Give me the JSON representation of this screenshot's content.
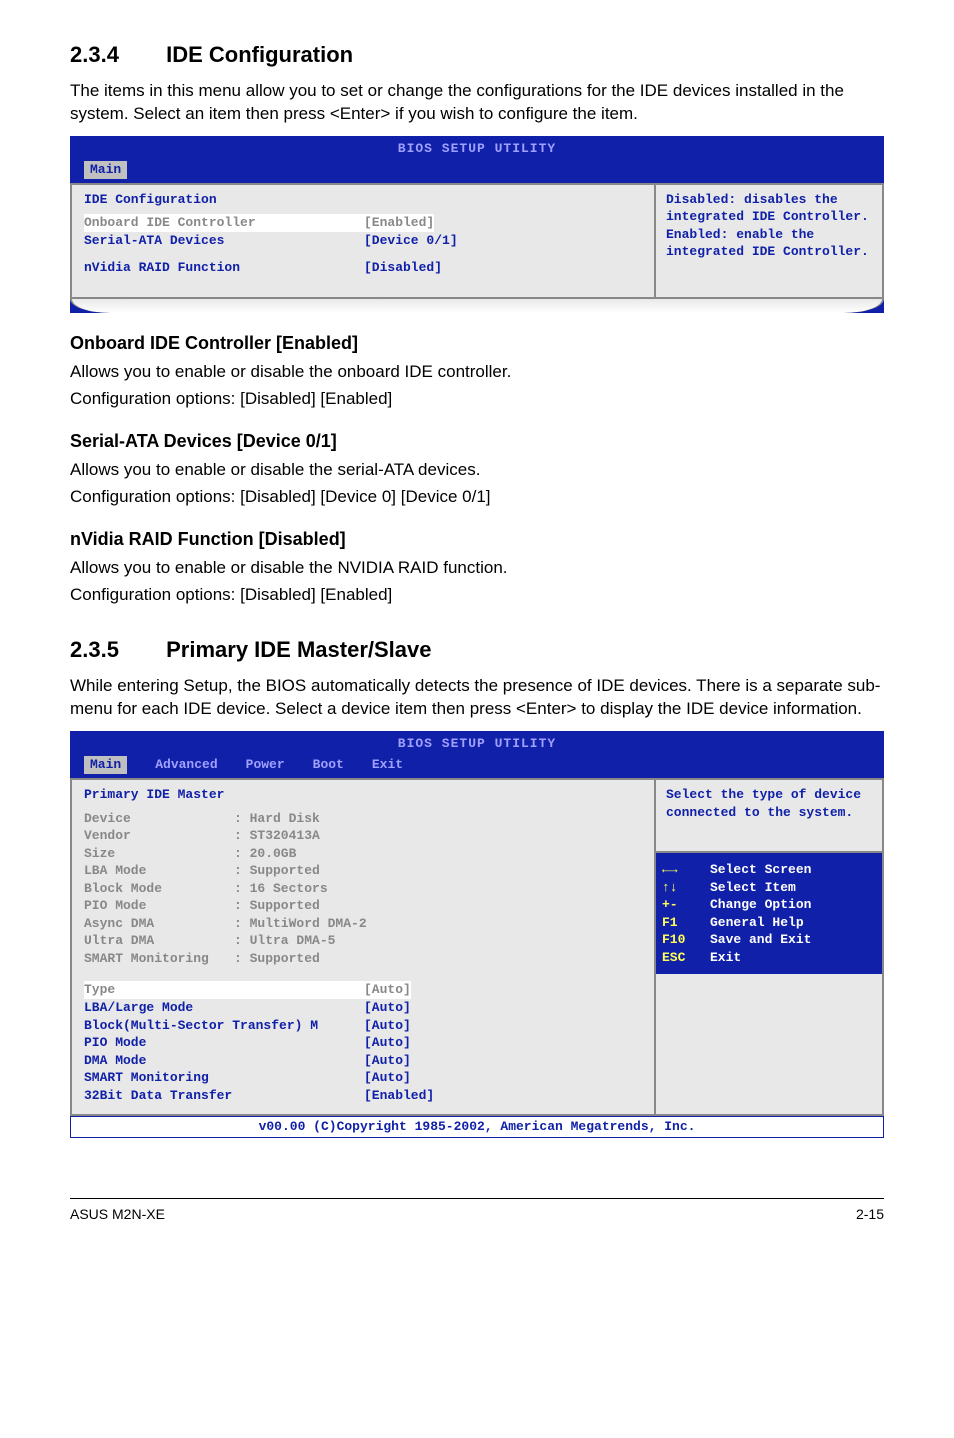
{
  "s234": {
    "num": "2.3.4",
    "title": "IDE Configuration",
    "intro": "The items in this menu allow you to set or change the configurations for the IDE devices installed in the system. Select an item then press <Enter> if you wish to configure the item.",
    "bios_title": "BIOS SETUP UTILITY",
    "tab_main": "Main",
    "panel_header": "IDE Configuration",
    "row1_label": "Onboard IDE Controller",
    "row1_value": "[Enabled]",
    "row2_label": "Serial-ATA Devices",
    "row2_value": "[Device 0/1]",
    "row3_label": "nVidia RAID Function",
    "row3_value": "[Disabled]",
    "help_text": "Disabled: disables the integrated IDE Controller.\nEnabled: enable the integrated IDE Controller.",
    "sub1_h": "Onboard IDE Controller [Enabled]",
    "sub1_p1": "Allows you to enable or disable the onboard IDE controller.",
    "sub1_p2": "Configuration options: [Disabled] [Enabled]",
    "sub2_h": "Serial-ATA Devices [Device 0/1]",
    "sub2_p1": "Allows you to enable or disable the serial-ATA devices.",
    "sub2_p2": "Configuration options: [Disabled] [Device 0] [Device 0/1]",
    "sub3_h": "nVidia RAID Function [Disabled]",
    "sub3_p1": "Allows you to enable or disable the NVIDIA RAID function.",
    "sub3_p2": "Configuration options: [Disabled] [Enabled]"
  },
  "s235": {
    "num": "2.3.5",
    "title": "Primary IDE Master/Slave",
    "intro": "While entering Setup, the BIOS automatically detects the presence of IDE devices. There is a separate sub-menu for each IDE device. Select a device item then press <Enter> to display the IDE device information.",
    "bios_title": "BIOS SETUP UTILITY",
    "tabs": {
      "main": "Main",
      "advanced": "Advanced",
      "power": "Power",
      "boot": "Boot",
      "exit": "Exit"
    },
    "panel_header": "Primary IDE Master",
    "info": [
      {
        "k": "Device",
        "v": ": Hard Disk"
      },
      {
        "k": "Vendor",
        "v": ": ST320413A"
      },
      {
        "k": "Size",
        "v": ": 20.0GB"
      },
      {
        "k": "LBA Mode",
        "v": ": Supported"
      },
      {
        "k": "Block Mode",
        "v": ": 16 Sectors"
      },
      {
        "k": "PIO Mode",
        "v": ": Supported"
      },
      {
        "k": "Async DMA",
        "v": ": MultiWord DMA-2"
      },
      {
        "k": "Ultra DMA",
        "v": ": Ultra DMA-5"
      },
      {
        "k": "SMART Monitoring",
        "v": ": Supported"
      }
    ],
    "rows": [
      {
        "label": "Type",
        "value": "[Auto]",
        "sel": true
      },
      {
        "label": "LBA/Large Mode",
        "value": "[Auto]"
      },
      {
        "label": "Block(Multi-Sector Transfer) M",
        "value": "[Auto]"
      },
      {
        "label": "PIO Mode",
        "value": "[Auto]"
      },
      {
        "label": "DMA Mode",
        "value": "[Auto]"
      },
      {
        "label": "SMART Monitoring",
        "value": "[Auto]"
      },
      {
        "label": "32Bit Data Transfer",
        "value": "[Enabled]"
      }
    ],
    "help_top": "Select the type of device connected to the system.",
    "helpkeys": [
      {
        "k": "←→",
        "d": "Select Screen"
      },
      {
        "k": "↑↓",
        "d": "Select Item"
      },
      {
        "k": "+-",
        "d": "Change Option"
      },
      {
        "k": "F1",
        "d": "General Help"
      },
      {
        "k": "F10",
        "d": "Save and Exit"
      },
      {
        "k": "ESC",
        "d": "Exit"
      }
    ],
    "copyright": "v00.00 (C)Copyright 1985-2002, American Megatrends, Inc."
  },
  "footer": {
    "left": "ASUS M2N-XE",
    "right": "2-15"
  }
}
